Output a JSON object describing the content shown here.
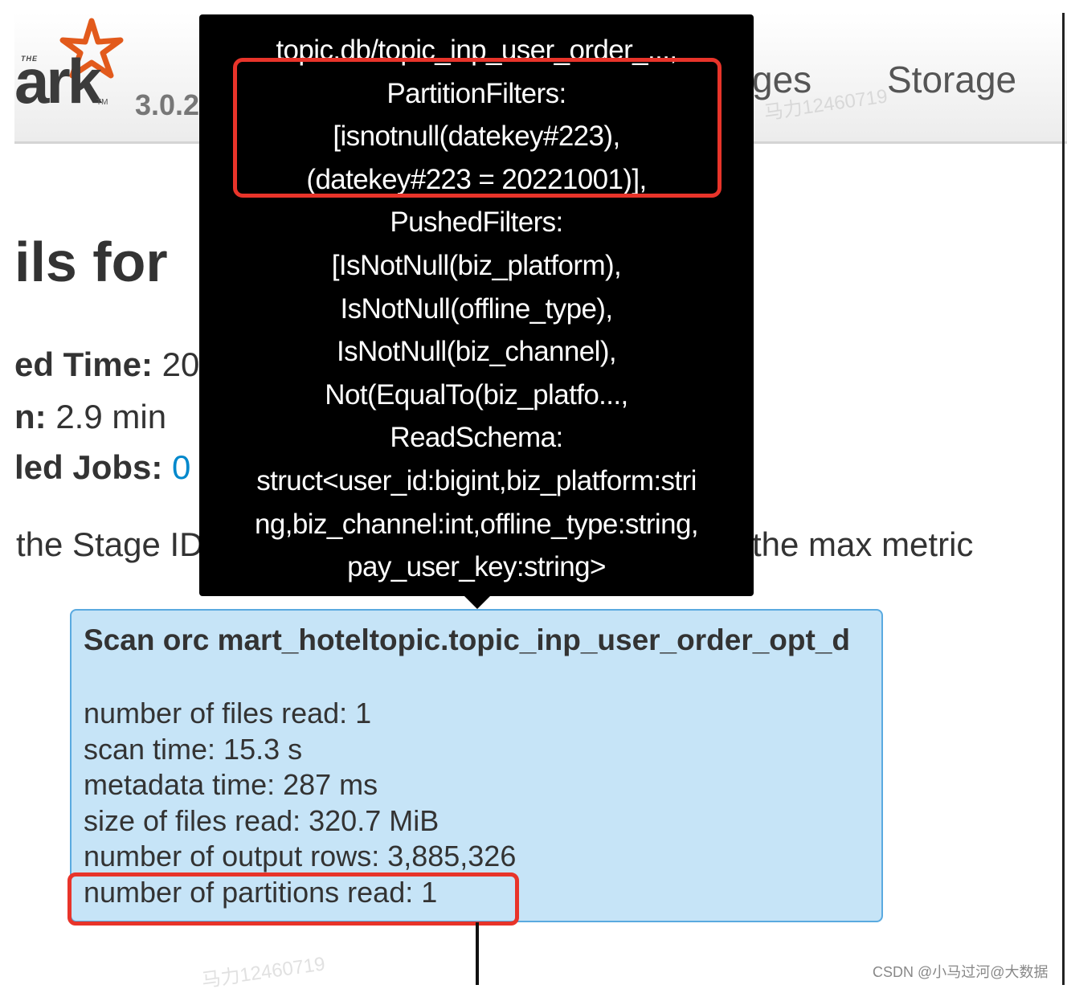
{
  "navbar": {
    "logo_the": "THE",
    "logo_text": "ark",
    "logo_tm": "TM",
    "version": "3.0.2",
    "tabs": {
      "stages": "ges",
      "storage": "Storage"
    }
  },
  "page": {
    "heading": "ils for",
    "submitted_time_label": "ed Time:",
    "submitted_time_value": "20",
    "duration_label": "n:",
    "duration_value": "2.9 min",
    "jobs_label": "led Jobs:",
    "jobs_value": "0",
    "hint_left": "the Stage ID",
    "hint_right": "the max metric"
  },
  "tooltip": {
    "lines": [
      "topic.db/topic_inp_user_order_...,",
      "PartitionFilters:",
      "[isnotnull(datekey#223),",
      "(datekey#223 = 20221001)],",
      "PushedFilters:",
      "[IsNotNull(biz_platform),",
      "IsNotNull(offline_type),",
      "IsNotNull(biz_channel),",
      "Not(EqualTo(biz_platfo...,",
      "ReadSchema:",
      "struct<user_id:bigint,biz_platform:stri",
      "ng,biz_channel:int,offline_type:string,",
      "pay_user_key:string>"
    ]
  },
  "node": {
    "title": "Scan orc mart_hoteltopic.topic_inp_user_order_opt_d",
    "metrics": [
      "number of files read: 1",
      "scan time: 15.3 s",
      "metadata time: 287 ms",
      "size of files read: 320.7 MiB",
      "number of output rows: 3,885,326",
      "number of partitions read: 1"
    ]
  },
  "watermark": {
    "text": "马力12460719",
    "credit": "CSDN @小马过河@大数据"
  },
  "colors": {
    "tooltip_bg": "#000000",
    "highlight": "#e8342a",
    "node_bg": "#c6e4f7",
    "node_border": "#5aaae0",
    "link": "#0088cc"
  }
}
